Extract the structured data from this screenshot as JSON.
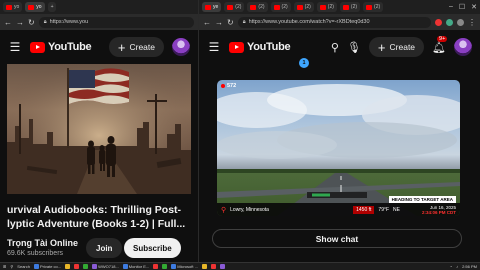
{
  "left_window": {
    "tabs": [
      {
        "label": "yo",
        "active": false
      },
      {
        "label": "yo",
        "active": true
      }
    ],
    "url": "https://www.you",
    "header": {
      "logo_text": "YouTube",
      "create_label": "Create"
    },
    "video": {
      "title_line1": "urvival Audiobooks: Thrilling Post-",
      "title_line2": "lyptic Adventure (Books 1-2) | Full...",
      "channel_name": "Trọng Tài Online",
      "subscribers": "69.6K subscribers",
      "join_label": "Join",
      "subscribe_label": "Subscribe"
    }
  },
  "right_window": {
    "tabs": [
      "ye",
      "(2)",
      "(2)",
      "(2)",
      "(2)",
      "(2)",
      "(2)",
      "(2)",
      "(2)",
      "(2)"
    ],
    "url": "https://www.youtube.com/watch?v=-rXBDteq0d30",
    "header": {
      "logo_text": "YouTube",
      "create_label": "Create",
      "notification_count": "9+"
    },
    "notif_dot": "1",
    "live": {
      "viewers": "572",
      "location": "Lowry, Minnesota",
      "distance": "1450 ft",
      "temperature": "79°F",
      "direction": "NE",
      "target_banner": "HEADING TO TARGET AREA",
      "date": "Jun 16, 2025",
      "time": "2:34:06 PM CDT"
    },
    "show_chat_label": "Show chat"
  },
  "taskbar": {
    "search_label": "Search",
    "items": [
      "Private co...",
      "",
      "",
      "",
      "WWO718...",
      "Monitor E...",
      "",
      "",
      "Microsoft ...",
      "",
      "",
      "",
      ""
    ],
    "clock": "2:56 PM"
  },
  "colors": {
    "background": "#0f0f0f",
    "youtube_red": "#ff0000",
    "accent_blue": "#3ea6ff"
  }
}
